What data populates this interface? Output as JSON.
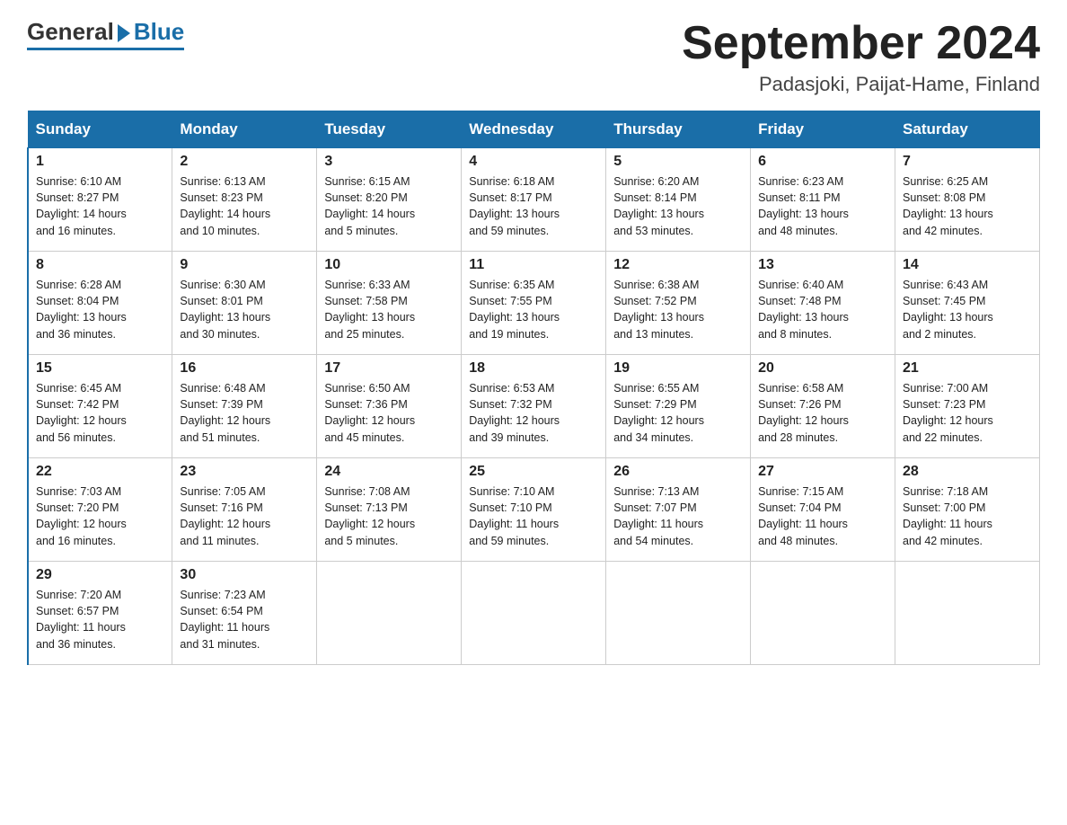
{
  "logo": {
    "general": "General",
    "blue": "Blue"
  },
  "header": {
    "title": "September 2024",
    "subtitle": "Padasjoki, Paijat-Hame, Finland"
  },
  "days_of_week": [
    "Sunday",
    "Monday",
    "Tuesday",
    "Wednesday",
    "Thursday",
    "Friday",
    "Saturday"
  ],
  "weeks": [
    [
      {
        "num": "1",
        "sunrise": "6:10 AM",
        "sunset": "8:27 PM",
        "daylight": "14 hours and 16 minutes."
      },
      {
        "num": "2",
        "sunrise": "6:13 AM",
        "sunset": "8:23 PM",
        "daylight": "14 hours and 10 minutes."
      },
      {
        "num": "3",
        "sunrise": "6:15 AM",
        "sunset": "8:20 PM",
        "daylight": "14 hours and 5 minutes."
      },
      {
        "num": "4",
        "sunrise": "6:18 AM",
        "sunset": "8:17 PM",
        "daylight": "13 hours and 59 minutes."
      },
      {
        "num": "5",
        "sunrise": "6:20 AM",
        "sunset": "8:14 PM",
        "daylight": "13 hours and 53 minutes."
      },
      {
        "num": "6",
        "sunrise": "6:23 AM",
        "sunset": "8:11 PM",
        "daylight": "13 hours and 48 minutes."
      },
      {
        "num": "7",
        "sunrise": "6:25 AM",
        "sunset": "8:08 PM",
        "daylight": "13 hours and 42 minutes."
      }
    ],
    [
      {
        "num": "8",
        "sunrise": "6:28 AM",
        "sunset": "8:04 PM",
        "daylight": "13 hours and 36 minutes."
      },
      {
        "num": "9",
        "sunrise": "6:30 AM",
        "sunset": "8:01 PM",
        "daylight": "13 hours and 30 minutes."
      },
      {
        "num": "10",
        "sunrise": "6:33 AM",
        "sunset": "7:58 PM",
        "daylight": "13 hours and 25 minutes."
      },
      {
        "num": "11",
        "sunrise": "6:35 AM",
        "sunset": "7:55 PM",
        "daylight": "13 hours and 19 minutes."
      },
      {
        "num": "12",
        "sunrise": "6:38 AM",
        "sunset": "7:52 PM",
        "daylight": "13 hours and 13 minutes."
      },
      {
        "num": "13",
        "sunrise": "6:40 AM",
        "sunset": "7:48 PM",
        "daylight": "13 hours and 8 minutes."
      },
      {
        "num": "14",
        "sunrise": "6:43 AM",
        "sunset": "7:45 PM",
        "daylight": "13 hours and 2 minutes."
      }
    ],
    [
      {
        "num": "15",
        "sunrise": "6:45 AM",
        "sunset": "7:42 PM",
        "daylight": "12 hours and 56 minutes."
      },
      {
        "num": "16",
        "sunrise": "6:48 AM",
        "sunset": "7:39 PM",
        "daylight": "12 hours and 51 minutes."
      },
      {
        "num": "17",
        "sunrise": "6:50 AM",
        "sunset": "7:36 PM",
        "daylight": "12 hours and 45 minutes."
      },
      {
        "num": "18",
        "sunrise": "6:53 AM",
        "sunset": "7:32 PM",
        "daylight": "12 hours and 39 minutes."
      },
      {
        "num": "19",
        "sunrise": "6:55 AM",
        "sunset": "7:29 PM",
        "daylight": "12 hours and 34 minutes."
      },
      {
        "num": "20",
        "sunrise": "6:58 AM",
        "sunset": "7:26 PM",
        "daylight": "12 hours and 28 minutes."
      },
      {
        "num": "21",
        "sunrise": "7:00 AM",
        "sunset": "7:23 PM",
        "daylight": "12 hours and 22 minutes."
      }
    ],
    [
      {
        "num": "22",
        "sunrise": "7:03 AM",
        "sunset": "7:20 PM",
        "daylight": "12 hours and 16 minutes."
      },
      {
        "num": "23",
        "sunrise": "7:05 AM",
        "sunset": "7:16 PM",
        "daylight": "12 hours and 11 minutes."
      },
      {
        "num": "24",
        "sunrise": "7:08 AM",
        "sunset": "7:13 PM",
        "daylight": "12 hours and 5 minutes."
      },
      {
        "num": "25",
        "sunrise": "7:10 AM",
        "sunset": "7:10 PM",
        "daylight": "11 hours and 59 minutes."
      },
      {
        "num": "26",
        "sunrise": "7:13 AM",
        "sunset": "7:07 PM",
        "daylight": "11 hours and 54 minutes."
      },
      {
        "num": "27",
        "sunrise": "7:15 AM",
        "sunset": "7:04 PM",
        "daylight": "11 hours and 48 minutes."
      },
      {
        "num": "28",
        "sunrise": "7:18 AM",
        "sunset": "7:00 PM",
        "daylight": "11 hours and 42 minutes."
      }
    ],
    [
      {
        "num": "29",
        "sunrise": "7:20 AM",
        "sunset": "6:57 PM",
        "daylight": "11 hours and 36 minutes."
      },
      {
        "num": "30",
        "sunrise": "7:23 AM",
        "sunset": "6:54 PM",
        "daylight": "11 hours and 31 minutes."
      },
      null,
      null,
      null,
      null,
      null
    ]
  ],
  "labels": {
    "sunrise": "Sunrise:",
    "sunset": "Sunset:",
    "daylight": "Daylight:"
  }
}
